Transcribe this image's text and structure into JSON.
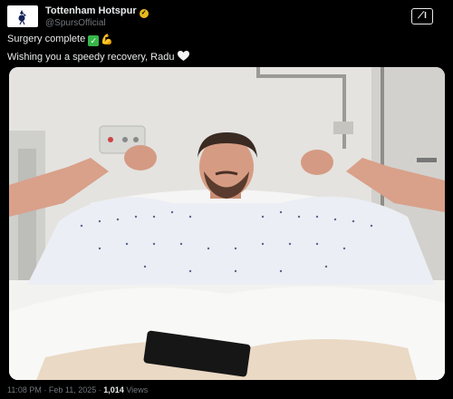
{
  "tweet": {
    "author_name": "Tottenham Hotspur",
    "author_handle": "@SpursOfficial",
    "line1": "Surgery complete",
    "line2": "Wishing you a speedy recovery, Radu",
    "time": "11:08 PM",
    "date": "Feb 11, 2025",
    "views_count": "1,014",
    "views_label": "Views"
  },
  "icons": {
    "avatar": "spurs-logo-icon",
    "verified": "verified-badge-icon",
    "grok": "grok-icon",
    "check": "check-mark-emoji",
    "flex": "flexed-biceps-emoji",
    "heart": "white-heart-emoji"
  },
  "colors": {
    "background": "#000000",
    "text_primary": "#e7e9ea",
    "text_secondary": "#71767b",
    "verified_gold": "#e8b91c"
  }
}
